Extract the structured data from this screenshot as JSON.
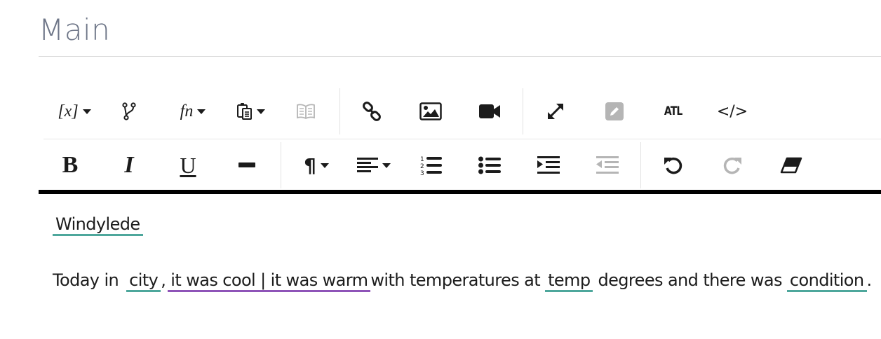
{
  "page": {
    "title": "Main"
  },
  "toolbar": {
    "variables_label": "[x]",
    "function_label": "fn",
    "atl_label": "ATL",
    "code_label": "</>",
    "bold_label": "B",
    "italic_label": "I",
    "underline_label": "U",
    "paragraph_label": "¶"
  },
  "editor": {
    "line1": {
      "token": "Windylede"
    },
    "line2": {
      "t1": "Today in",
      "city": "city",
      "comma": ",",
      "alt": "it was cool | it was warm",
      "t2": "with temperatures at",
      "temp": "temp",
      "t3": "degrees and there was",
      "condition": "condition",
      "period": "."
    }
  },
  "colors": {
    "variable_underline": "#4ea79c",
    "alternation_underline": "#8e54b8"
  }
}
